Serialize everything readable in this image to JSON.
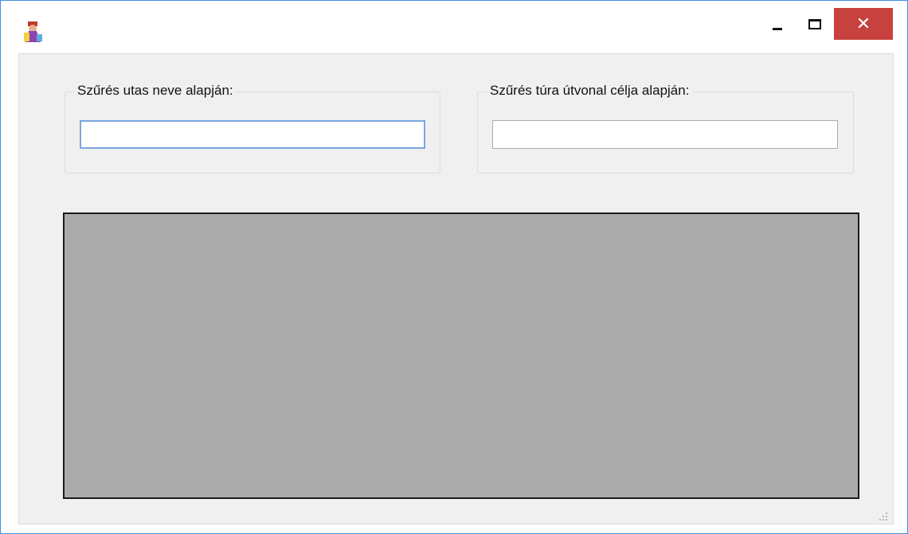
{
  "window": {
    "title": "",
    "icon": "app-icon",
    "controls": {
      "minimize": "minimize-icon",
      "maximize": "maximize-icon",
      "close": "✕"
    },
    "close_color": "#c7413e",
    "border_color": "#3c8ee0"
  },
  "filters": {
    "passenger_name": {
      "label": "Szűrés utas neve alapján:",
      "value": ""
    },
    "route_destination": {
      "label": "Szűrés túra útvonal célja alapján:",
      "value": ""
    }
  },
  "data_grid": {
    "background_color": "#ababab"
  }
}
